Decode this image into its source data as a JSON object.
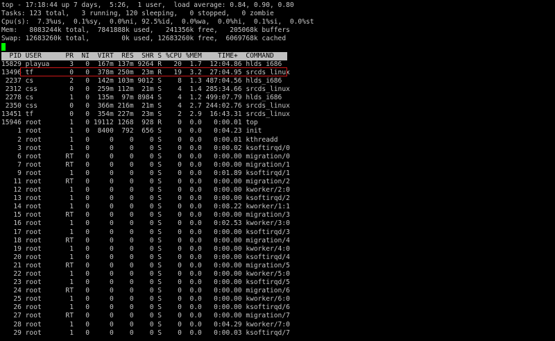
{
  "summary": {
    "line1": "top - 17:18:44 up 7 days,  5:26,  1 user,  load average: 0.84, 0.90, 0.80",
    "line2": "Tasks: 123 total,   3 running, 120 sleeping,   0 stopped,   0 zombie",
    "line3": "Cpu(s):  7.3%us,  0.1%sy,  0.0%ni, 92.5%id,  0.0%wa,  0.0%hi,  0.1%si,  0.0%st",
    "line4": "Mem:   8083244k total,  7841888k used,   241356k free,   205068k buffers",
    "line5": "Swap: 12683260k total,        0k used, 12683260k free,  6069768k cached"
  },
  "table": {
    "header": "  PID USER      PR  NI  VIRT  RES  SHR S %CPU %MEM    TIME+  COMMAND",
    "rows": [
      "15829 playua     3   0  167m 137m 9264 R   20  1.7  12:04.86 hlds_i686",
      "13496 tf         0   0  378m 250m  23m R   19  3.2  27:04.95 srcds_linux",
      " 2237 cs         2   0  142m 103m 9012 S    8  1.3 487:04.56 hlds_i686",
      " 2312 css        0   0  259m 112m  21m S    4  1.4 285:34.66 srcds_linux",
      " 2278 cs         1   0  135m  97m 8984 S    4  1.2 499:07.79 hlds_i686",
      " 2350 css        0   0  366m 216m  21m S    4  2.7 244:02.76 srcds_linux",
      "13451 tf         0   0  354m 227m  23m S    2  2.9  16:43.31 srcds_linux",
      "15946 root       1   0 19112 1268  928 R    0  0.0   0:00.01 top",
      "    1 root       1   0  8400  792  656 S    0  0.0   0:04.23 init",
      "    2 root       1   0     0    0    0 S    0  0.0   0:00.01 kthreadd",
      "    3 root       1   0     0    0    0 S    0  0.0   0:00.02 ksoftirqd/0",
      "    6 root      RT   0     0    0    0 S    0  0.0   0:00.00 migration/0",
      "    7 root      RT   0     0    0    0 S    0  0.0   0:00.00 migration/1",
      "    9 root       1   0     0    0    0 S    0  0.0   0:01.89 ksoftirqd/1",
      "   11 root      RT   0     0    0    0 S    0  0.0   0:00.00 migration/2",
      "   12 root       1   0     0    0    0 S    0  0.0   0:00.00 kworker/2:0",
      "   13 root       1   0     0    0    0 S    0  0.0   0:00.00 ksoftirqd/2",
      "   14 root       1   0     0    0    0 S    0  0.0   0:08.22 kworker/1:1",
      "   15 root      RT   0     0    0    0 S    0  0.0   0:00.00 migration/3",
      "   16 root       1   0     0    0    0 S    0  0.0   0:02.53 kworker/3:0",
      "   17 root       1   0     0    0    0 S    0  0.0   0:00.00 ksoftirqd/3",
      "   18 root      RT   0     0    0    0 S    0  0.0   0:00.00 migration/4",
      "   19 root       1   0     0    0    0 S    0  0.0   0:00.00 kworker/4:0",
      "   20 root       1   0     0    0    0 S    0  0.0   0:00.00 ksoftirqd/4",
      "   21 root      RT   0     0    0    0 S    0  0.0   0:00.00 migration/5",
      "   22 root       1   0     0    0    0 S    0  0.0   0:00.00 kworker/5:0",
      "   23 root       1   0     0    0    0 S    0  0.0   0:00.00 ksoftirqd/5",
      "   24 root      RT   0     0    0    0 S    0  0.0   0:00.00 migration/6",
      "   25 root       1   0     0    0    0 S    0  0.0   0:00.00 kworker/6:0",
      "   26 root       1   0     0    0    0 S    0  0.0   0:00.00 ksoftirqd/6",
      "   27 root      RT   0     0    0    0 S    0  0.0   0:00.00 migration/7",
      "   28 root       1   0     0    0    0 S    0  0.0   0:04.29 kworker/7:0",
      "   29 root       1   0     0    0    0 S    0  0.0   0:00.03 ksoftirqd/7"
    ]
  },
  "colors": {
    "background": "#000000",
    "text": "#c8c8c8",
    "header_bar": "#c0c0c0",
    "cursor": "#00ff00",
    "highlight_box": "#d01818"
  }
}
